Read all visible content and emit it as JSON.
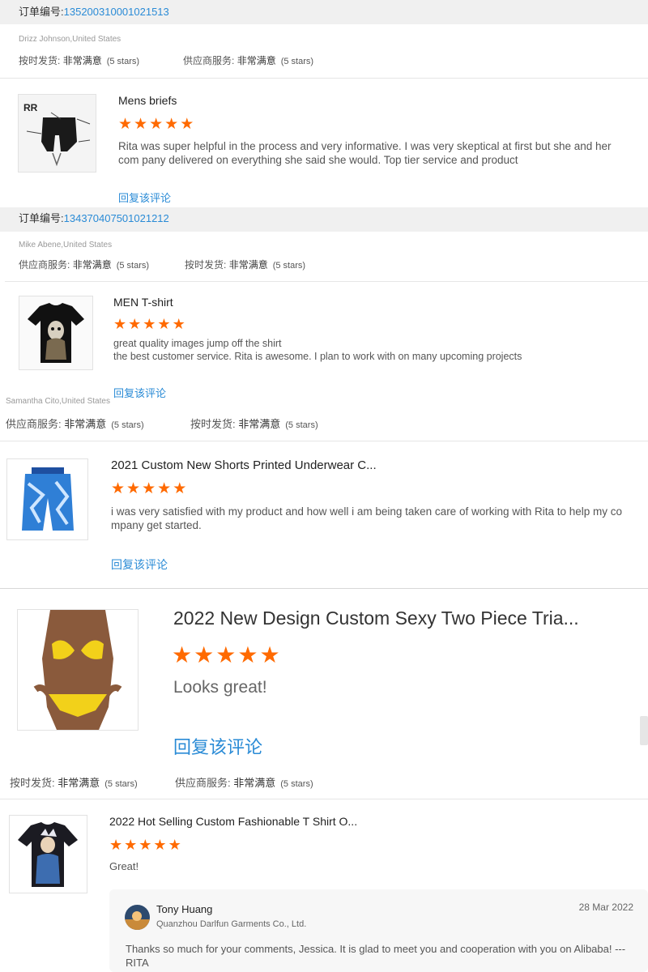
{
  "reviews": [
    {
      "order_label": "订单编号:",
      "order_no": "135200310001021513",
      "buyer": "Drizz Johnson,United States",
      "ratings": [
        {
          "label": "按时发货:",
          "value": "非常满意",
          "stars": "(5 stars)"
        },
        {
          "label": "供应商服务:",
          "value": "非常满意",
          "stars": "(5 stars)"
        }
      ],
      "product": "Mens briefs",
      "text": "Rita was super helpful in the process and very informative. I was very skeptical at first but she and her com pany delivered on everything she said she would. Top tier service and product",
      "reply": "回复该评论"
    },
    {
      "order_label": "订单编号:",
      "order_no": "134370407501021212",
      "buyer": "Mike Abene,United States",
      "ratings": [
        {
          "label": "供应商服务:",
          "value": "非常满意",
          "stars": "(5 stars)"
        },
        {
          "label": "按时发货:",
          "value": "非常满意",
          "stars": "(5 stars)"
        }
      ],
      "product": "MEN T-shirt",
      "text_lines": [
        "great quality images jump off the shirt",
        "the best customer service. Rita is awesome. I plan to work with on many upcoming projects"
      ],
      "reply": "回复该评论"
    },
    {
      "buyer": "Samantha Cito,United States",
      "ratings": [
        {
          "label": "供应商服务:",
          "value": "非常满意",
          "stars": "(5 stars)"
        },
        {
          "label": "按时发货:",
          "value": "非常满意",
          "stars": "(5 stars)"
        }
      ],
      "product": "2021 Custom New Shorts Printed Underwear C...",
      "text": "i was very satisfied with my product and how well i am being taken care of working with Rita to help my co mpany get started.",
      "reply": "回复该评论"
    },
    {
      "product": "2022 New Design Custom Sexy Two Piece Tria...",
      "text": "Looks great!",
      "reply": "回复该评论",
      "ratings": [
        {
          "label": "按时发货:",
          "value": "非常满意",
          "stars": "(5 stars)"
        },
        {
          "label": "供应商服务:",
          "value": "非常满意",
          "stars": "(5 stars)"
        }
      ]
    },
    {
      "product": "2022 Hot Selling Custom Fashionable T Shirt O...",
      "text": "Great!",
      "seller_reply": {
        "name": "Tony Huang",
        "company": "Quanzhou Darlfun Garments Co., Ltd.",
        "date": "28 Mar 2022",
        "text": "Thanks so much for your comments, Jessica. It is glad to meet you and cooperation with you on Alibaba! ---RITA"
      }
    }
  ],
  "star_rating": 5,
  "colors": {
    "star": "#ff6a00",
    "link": "#2a8bd6",
    "order_bar": "#f0f0f0"
  },
  "icons": {
    "star": "star-icon",
    "avatar": "avatar"
  }
}
